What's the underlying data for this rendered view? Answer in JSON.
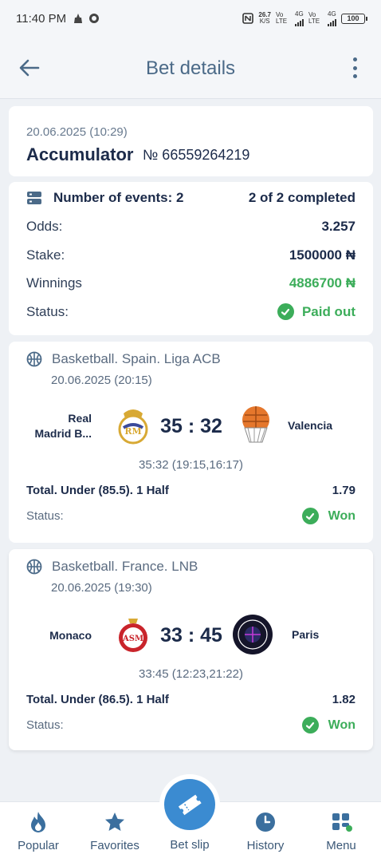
{
  "status_bar": {
    "time": "11:40 PM",
    "net_speed": "26.7",
    "net_unit": "K/S",
    "carrier1": "Vo LTE",
    "carrier1_gen": "4G",
    "carrier2": "Vo LTE",
    "carrier2_gen": "4G",
    "battery": "100"
  },
  "header": {
    "title": "Bet details"
  },
  "bet": {
    "date": "20.06.2025 (10:29)",
    "type": "Accumulator",
    "number": "№ 66559264219"
  },
  "summary": {
    "events_label": "Number of events: 2",
    "completed": "2 of 2 completed",
    "odds_label": "Odds:",
    "odds_value": "3.257",
    "stake_label": "Stake:",
    "stake_value": "1500000 ₦",
    "winnings_label": "Winnings",
    "winnings_value": "4886700 ₦",
    "status_label": "Status:",
    "status_value": "Paid out"
  },
  "events": [
    {
      "league": "Basketball. Spain. Liga ACB",
      "date": "20.06.2025 (20:15)",
      "home_line1": "Real",
      "home_line2": "Madrid B...",
      "away": "Valencia",
      "score": "35 : 32",
      "periods": "35:32 (19:15,16:17)",
      "market": "Total. Under (85.5). 1 Half",
      "odds": "1.79",
      "status_label": "Status:",
      "status": "Won"
    },
    {
      "league": "Basketball. France. LNB",
      "date": "20.06.2025 (19:30)",
      "home": "Monaco",
      "away": "Paris",
      "score": "33 : 45",
      "periods": "33:45 (12:23,21:22)",
      "market": "Total. Under (86.5). 1 Half",
      "odds": "1.82",
      "status_label": "Status:",
      "status": "Won"
    }
  ],
  "nav": {
    "popular": "Popular",
    "favorites": "Favorites",
    "betslip": "Bet slip",
    "history": "History",
    "menu": "Menu"
  },
  "colors": {
    "accent": "#3b8bd1",
    "success": "#3cad5a",
    "title": "#4b6a88",
    "text_dark": "#1c2b4a"
  }
}
